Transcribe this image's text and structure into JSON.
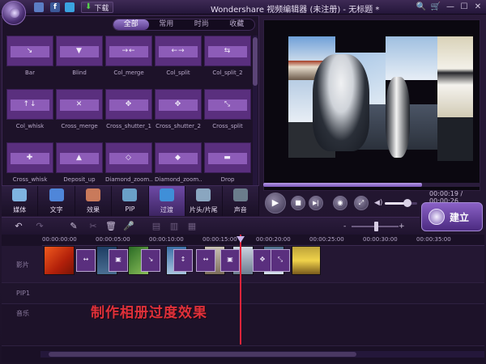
{
  "titlebar": {
    "download_label": "下载",
    "app_title": "Wondershare 视频编辑器 (未注册) - 无标题 *",
    "facebook_glyph": "f",
    "controls": [
      "🔍",
      "🛒",
      "—",
      "☐",
      "✕"
    ]
  },
  "library": {
    "filter_tabs": [
      "全部",
      "常用",
      "时尚",
      "收藏"
    ],
    "active_filter": "全部",
    "transitions": [
      {
        "name": "Bar",
        "glyph": "↘"
      },
      {
        "name": "Blind",
        "glyph": "▼"
      },
      {
        "name": "Col_merge",
        "glyph": "→←"
      },
      {
        "name": "Col_split",
        "glyph": "←→"
      },
      {
        "name": "Col_split_2",
        "glyph": "⇆"
      },
      {
        "name": "Col_whisk",
        "glyph": "↑↓"
      },
      {
        "name": "Cross_merge",
        "glyph": "✕"
      },
      {
        "name": "Cross_shutter_1",
        "glyph": "✥"
      },
      {
        "name": "Cross_shutter_2",
        "glyph": "✥"
      },
      {
        "name": "Cross_split",
        "glyph": "⤡"
      },
      {
        "name": "Cross_whisk",
        "glyph": "✚"
      },
      {
        "name": "Deposit_up",
        "glyph": "▲"
      },
      {
        "name": "Diamond_zoom...",
        "glyph": "◇"
      },
      {
        "name": "Diamond_zoom...",
        "glyph": "◆"
      },
      {
        "name": "Drop",
        "glyph": "▬"
      }
    ]
  },
  "categories": [
    {
      "label": "媒体",
      "color": "#7fb3e0"
    },
    {
      "label": "文字",
      "color": "#4f86d9"
    },
    {
      "label": "效果",
      "color": "#c97a5b"
    },
    {
      "label": "PIP",
      "color": "#6aa0c8"
    },
    {
      "label": "过渡",
      "color": "#3f8fd8"
    },
    {
      "label": "片头/片尾",
      "color": "#8aa6c0"
    },
    {
      "label": "声音",
      "color": "#6b7d8c"
    }
  ],
  "active_category": "过渡",
  "player": {
    "time_readout": "00:00:19 / 00:00:26",
    "progress": 0.73,
    "volume": 0.6,
    "glyphs": {
      "play": "▶",
      "stop": "■",
      "next": "▶|",
      "snapshot": "◉",
      "fullscreen": "⤢",
      "volume": "◀)"
    }
  },
  "create_label": "建立",
  "toolbar_glyphs": [
    "↶",
    "↷",
    "✎",
    "✂",
    "🗑",
    "🎤",
    "▤",
    "▥",
    "▦"
  ],
  "zoom": {
    "minus": "-",
    "plus": "+",
    "level": 0.5
  },
  "ruler_labels": [
    "00:00:00:00",
    "00:00:05:00",
    "00:00:10:00",
    "00:00:15:00",
    "00:00:20:00",
    "00:00:25:00",
    "00:00:30:00",
    "00:00:35:00"
  ],
  "tracks": [
    "影片",
    "PIP1",
    "音乐"
  ],
  "transition_marks": [
    "↔",
    "▣",
    "↘",
    "↕",
    "↔",
    "▣",
    "✥",
    "⤡"
  ],
  "caption": "制作相册过度效果"
}
